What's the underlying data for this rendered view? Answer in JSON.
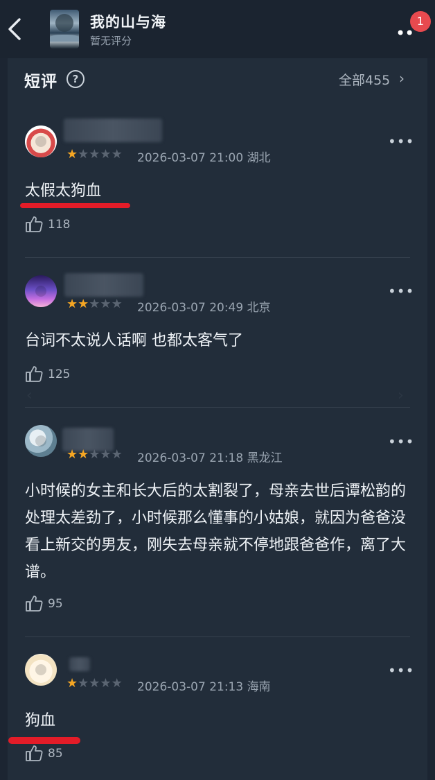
{
  "header": {
    "title": "我的山与海",
    "subtitle": "暂无评分",
    "badge_count": "1"
  },
  "section": {
    "title": "短评",
    "all_label": "全部455",
    "help_glyph": "?"
  },
  "reviews": [
    {
      "rating": 1,
      "stars": "★★★★★",
      "meta": "2026-03-07 21:00 湖北",
      "text": "太假太狗血",
      "likes": "118"
    },
    {
      "rating": 2,
      "stars": "★★★★★",
      "meta": "2026-03-07 20:49 北京",
      "text": "台词不太说人话啊 也都太客气了",
      "likes": "125"
    },
    {
      "rating": 2,
      "stars": "★★★★★",
      "meta": "2026-03-07 21:18 黑龙江",
      "text": "小时候的女主和长大后的太割裂了，母亲去世后谭松韵的处理太差劲了，小时候那么懂事的小姑娘，就因为爸爸没看上新交的男友，刚失去母亲就不停地跟爸爸作，离了大谱。",
      "likes": "95"
    },
    {
      "rating": 1,
      "stars": "★★★★★",
      "meta": "2026-03-07 21:13 海南",
      "text": "狗血",
      "likes": "85"
    }
  ],
  "icons": {
    "back": "back-arrow-icon",
    "more": "more-icon",
    "help": "help-icon",
    "chevron": "chevron-right-icon",
    "like": "thumbs-up-icon"
  },
  "colors": {
    "star_on": "#f5a623",
    "star_off": "#5b6572",
    "badge": "#e84a4f",
    "annotation_line": "#e31c28"
  }
}
